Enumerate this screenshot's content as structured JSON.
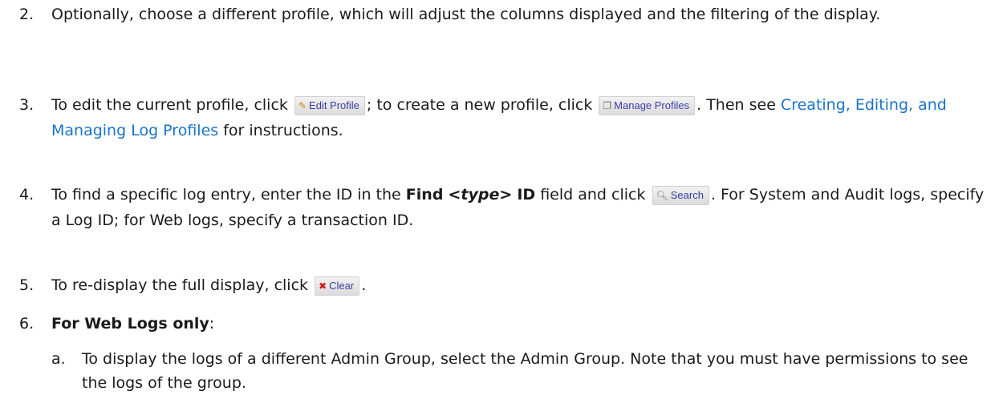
{
  "steps": [
    {
      "number": "2.",
      "text": "Optionally, choose a different profile, which will adjust the columns displayed and the filtering of the display."
    },
    {
      "number": "3.",
      "part1": "To edit the current profile, click",
      "part2": "; to create a new profile, click",
      "part3": ". Then see",
      "link": "Creating, Editing, and Managing Log Profiles",
      "part4": "for instructions."
    },
    {
      "number": "4.",
      "part1": "To find a specific log entry, enter the ID in the",
      "bold1": "Find",
      "italic": "<type>",
      "bold2": "ID",
      "part2": "field and click",
      "part3": ". For System and Audit logs, specify a Log ID; for Web logs, specify a transaction ID."
    },
    {
      "number": "5.",
      "part1": "To re-display the full display, click",
      "part2": "."
    },
    {
      "number": "6.",
      "bold": "For Web Logs only",
      "suffix": ":"
    }
  ],
  "substeps": [
    {
      "letter": "a.",
      "text": "To display the logs of a different Admin Group, select the Admin Group. Note that you must have permissions to see the logs of the group."
    }
  ],
  "buttons": {
    "edit_profile": {
      "label": "Edit Profile",
      "icon": "edit-icon"
    },
    "manage_profiles": {
      "label": "Manage Profiles",
      "icon": "manage-icon"
    },
    "search": {
      "label": "Search",
      "icon": "search-icon"
    },
    "clear": {
      "label": "Clear",
      "icon": "clear-icon"
    }
  },
  "colors": {
    "link": "#1a73c8",
    "button_text": "#3a3fa8",
    "clear_icon": "#d01818"
  }
}
